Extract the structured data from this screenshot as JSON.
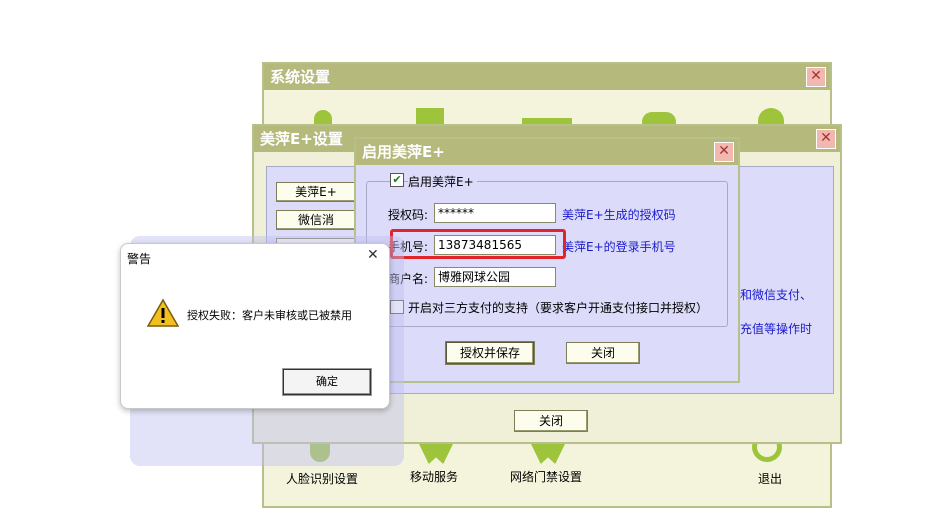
{
  "system_window": {
    "title": "系统设置",
    "close_glyph": "✕",
    "bottom_items": [
      {
        "label": "人脸识别设置",
        "icon": "face-recognition-icon"
      },
      {
        "label": "移动服务",
        "icon": "mobile-service-icon"
      },
      {
        "label": "网络门禁设置",
        "icon": "access-control-icon"
      },
      {
        "label": "退出",
        "icon": "power-icon"
      }
    ]
  },
  "meiping_window": {
    "title": "美萍E+设置",
    "close_glyph": "✕",
    "side_buttons": [
      "美萍E+",
      "微信消",
      "..."
    ],
    "right_text_1": "和微信支付、",
    "right_text_2": "充值等操作时",
    "close_button": "关闭"
  },
  "enable_dialog": {
    "title": "启用美萍E+",
    "close_glyph": "✕",
    "enable_checkbox_label": "启用美萍E+",
    "enable_checked": true,
    "auth_code_label": "授权码:",
    "auth_code_value": "******",
    "auth_code_hint": "美萍E+生成的授权码",
    "phone_label": "手机号:",
    "phone_value": "13873481565",
    "phone_hint": "美萍E+的登录手机号",
    "merchant_label": "商户名:",
    "merchant_value": "博雅网球公园",
    "third_party_label": "开启对三方支付的支持（要求客户开通支付接口并授权）",
    "third_party_checked": false,
    "authorize_save_button": "授权并保存",
    "close_button": "关闭"
  },
  "alert": {
    "title": "警告",
    "close_glyph": "✕",
    "message": "授权失败：客户未审核或已被禁用",
    "ok_button": "确定"
  },
  "colors": {
    "title_bar": "#b5b97c",
    "panel_lavender": "#dcdcfa",
    "highlight_red": "#e0242a",
    "link_blue": "#1a1acc"
  }
}
